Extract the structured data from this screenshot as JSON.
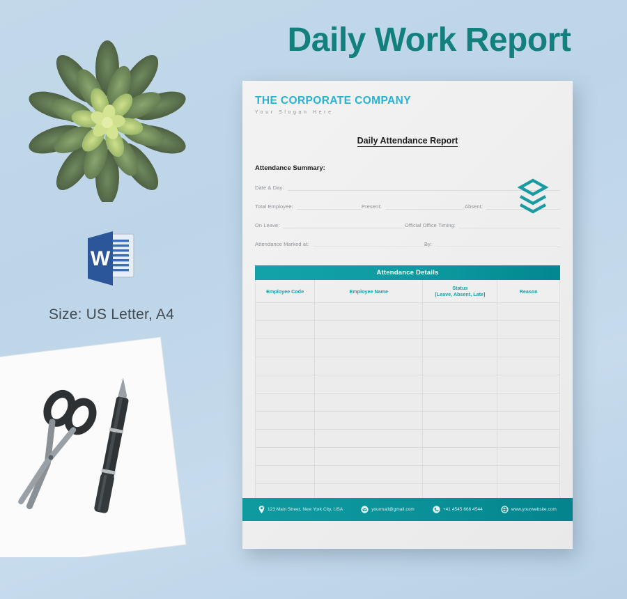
{
  "headline": "Daily Work Report",
  "sidebar": {
    "plant_alt": "succulent-plant-photo",
    "file_format_icon": "microsoft-word-icon",
    "word_letter": "W",
    "size_label": "Size: US Letter, A4",
    "desk_photo_alt": "paper-scissors-pen-photo"
  },
  "document": {
    "brand_name": "THE CORPORATE COMPANY",
    "brand_slogan": "Your Slogan Here",
    "logo_icon": "stacked-layers-hexagon-logo",
    "title": "Daily Attendance Report",
    "summary_heading": "Attendance Summary:",
    "fields": {
      "date_day": "Date & Day:",
      "total_employee": "Total Employee:",
      "present": "Present:",
      "absent": "Absent:",
      "on_leave": "On Leave:",
      "official_office_timing": "Official Office Timing:",
      "attendance_marked_at": "Attendance Marked at:",
      "by": "By:"
    },
    "table": {
      "banner": "Attendance Details",
      "columns": [
        "Employee Code",
        "Employee Name",
        "Status",
        "Reason"
      ],
      "status_sub": "[Leave, Absent, Late]",
      "empty_rows": 12
    },
    "footer": {
      "address": "123 Main Street, New York City, USA",
      "email": "yourmail@gmail.com",
      "phone": "+41 4545 666 4544",
      "website": "www.yourwebsite.com",
      "icons": [
        "location-pin-icon",
        "envelope-icon",
        "phone-icon",
        "globe-icon"
      ]
    }
  },
  "colors": {
    "background": "#bdd5e8",
    "headline_teal": "#13807e",
    "brand_blue": "#27b4d4",
    "accent_teal": "#0e9aa0",
    "table_header_teal": "#18a1a8",
    "word_blue": "#2b579a"
  }
}
